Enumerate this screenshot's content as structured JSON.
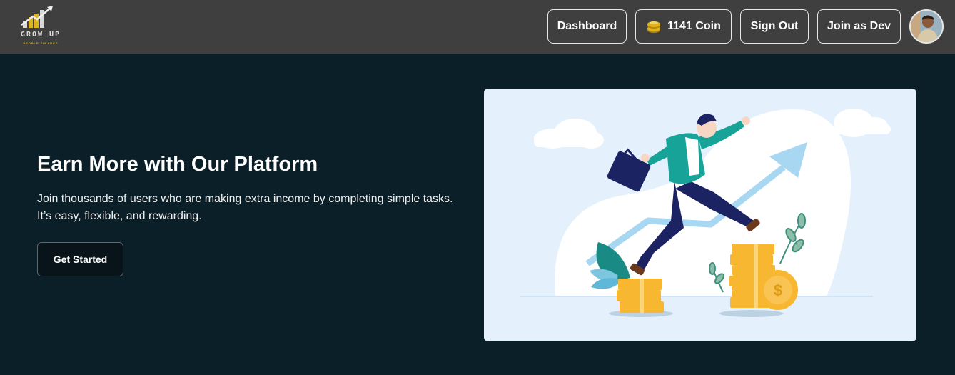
{
  "brand": {
    "name": "GROW UP",
    "tagline": "PEOPLE FINANCE"
  },
  "nav": {
    "dashboard_label": "Dashboard",
    "coin_label": "1141 Coin",
    "signout_label": "Sign Out",
    "joindev_label": "Join as Dev",
    "avatar_icon": "user-avatar"
  },
  "hero": {
    "title": "Earn More with Our Platform",
    "description": "Join thousands of users who are making extra income by completing simple tasks. It’s easy, flexible, and rewarding.",
    "cta_label": "Get Started",
    "illustration_icon": "businessman-climbing-coins-illustration"
  },
  "colors": {
    "navbar_bg": "#3f3f3f",
    "page_bg": "#0a1f27",
    "illustration_bg": "#e4f0fb",
    "coin_gold": "#f7b731",
    "accent_teal": "#17a398",
    "suit_navy": "#1c2363"
  }
}
